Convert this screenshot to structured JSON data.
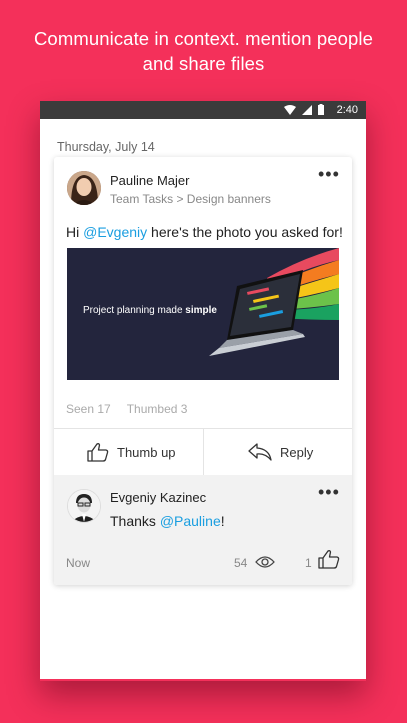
{
  "headline": {
    "line1": "Communicate in context. mention people",
    "line2": "and share files"
  },
  "statusbar": {
    "time": "2:40"
  },
  "feed": {
    "date": "Thursday, July 14"
  },
  "post": {
    "author": "Pauline Majer",
    "context": "Team Tasks > Design banners",
    "message_prefix": "Hi ",
    "mention": "@Evgeniy",
    "message_suffix": " here's the photo you asked for!",
    "banner_text": "Project planning made ",
    "banner_text_bold": "simple",
    "seen": "Seen 17",
    "thumbed": "Thumbed 3",
    "thumb_up_label": "Thumb up",
    "reply_label": "Reply"
  },
  "reply": {
    "author": "Evgeniy Kazinec",
    "message_prefix": "Thanks ",
    "mention": "@Pauline",
    "message_suffix": "!",
    "time": "Now",
    "views": "54",
    "likes": "1"
  },
  "colors": {
    "background": "#f4305a",
    "mention": "#1a9ee0",
    "banner": "#23253d"
  },
  "icons": [
    "wifi-icon",
    "signal-icon",
    "battery-icon",
    "more-icon",
    "thumb-up-icon",
    "reply-icon",
    "eye-icon"
  ]
}
